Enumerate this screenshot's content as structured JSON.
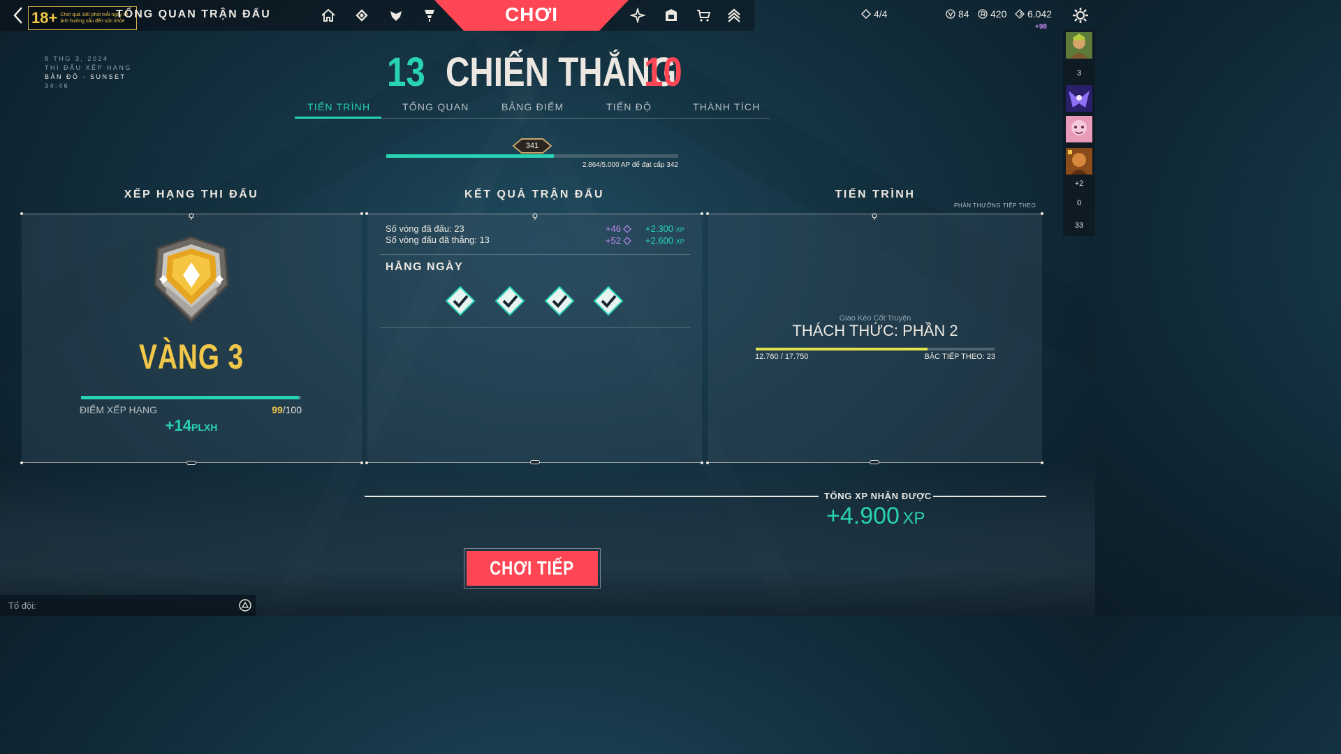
{
  "header": {
    "age_rating": "18+",
    "age_warning": "Chơi quá 180 phút mỗi ngày sẽ ảnh hưởng xấu đến sức khỏe",
    "title": "TỔNG QUAN TRẬN ĐẤU",
    "play_label": "CHƠI",
    "nav_left_icons": [
      "home-icon",
      "career-icon",
      "agents-icon",
      "collection-icon"
    ],
    "nav_right_icons": [
      "battlepass-icon",
      "locker-icon",
      "store-icon",
      "rank-icon"
    ]
  },
  "currency": {
    "kingdom_credits": "4/4",
    "valorant_points": "84",
    "radianite": "420",
    "kingdom_points": "6.042",
    "bonus": "+98"
  },
  "party": {
    "count_1": "3",
    "count_more": "+2",
    "count_2": "0",
    "count_3": "33"
  },
  "match": {
    "date": "8 THG 3, 2024",
    "mode": "THI ĐẤU XẾP HẠNG",
    "map": "BẢN ĐỒ - SUNSET",
    "duration": "34:46",
    "score_ours": "13",
    "result": "CHIẾN THẮNG",
    "score_theirs": "10"
  },
  "tabs": [
    "TIẾN TRÌNH",
    "TỔNG QUAN",
    "BẢNG ĐIỂM",
    "TIẾN ĐỘ",
    "THÀNH TÍCH"
  ],
  "account_level": {
    "level": "341",
    "progress_text": "2.864/5.000 AP để đạt cấp 342",
    "progress": 0.573
  },
  "rank": {
    "section_title": "XẾP HẠNG THI ĐẤU",
    "tier": "VÀNG 3",
    "rr_label": "ĐIỂM XẾP HẠNG",
    "rr_current": "99",
    "rr_max": "/100",
    "rr_progress": 0.99,
    "rr_gain": "+14",
    "rr_unit": "PLXH"
  },
  "results": {
    "section_title": "KẾT QUẢ TRẬN ĐẤU",
    "rows": [
      {
        "label": "Số vòng đã đấu: 23",
        "rp": "+46",
        "xp": "+2.300",
        "xp_unit": "XP"
      },
      {
        "label": "Số vòng đấu đã thắng: 13",
        "rp": "+52",
        "xp": "+2.600",
        "xp_unit": "XP"
      }
    ],
    "daily_title": "HẰNG NGÀY",
    "daily_checks": 4
  },
  "progress": {
    "section_title": "TIẾN TRÌNH",
    "next_reward": "PHẦN THƯỞNG TIẾP THEO",
    "contract_type": "Giao Kèo Cốt Truyện",
    "contract_name": "THÁCH THỨC: PHẦN 2",
    "contract_xp": "12.760 / 17.750",
    "contract_progress": 0.719,
    "next_tier": "BẬC TIẾP THEO: 23"
  },
  "total_xp": {
    "label": "TỔNG XP NHẬN ĐƯỢC",
    "value": "+4.900",
    "unit": "XP"
  },
  "continue_label": "CHƠI TIẾP",
  "chat": {
    "placeholder": "Tổ đội:"
  },
  "colors": {
    "accent_teal": "#27d3b2",
    "accent_red": "#ff4655",
    "gold": "#f1c74a",
    "purple": "#c58bf5"
  }
}
